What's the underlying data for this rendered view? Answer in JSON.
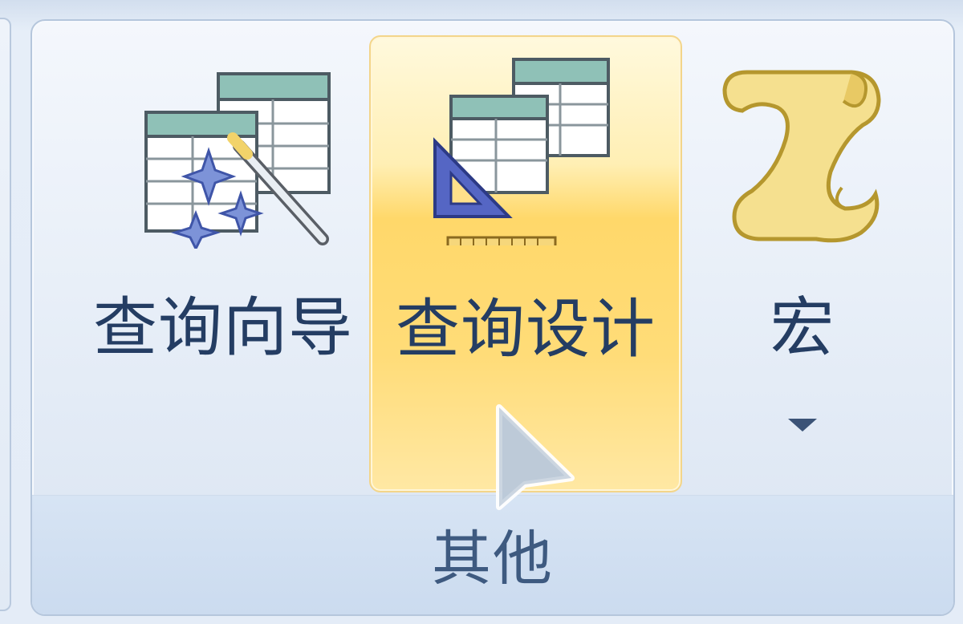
{
  "group": {
    "label": "其他"
  },
  "buttons": {
    "query_wizard": {
      "label": "查询向导",
      "icon": "query-wizard-icon"
    },
    "query_design": {
      "label": "查询设计",
      "icon": "query-design-icon",
      "state": "hover"
    },
    "macro": {
      "label": "宏",
      "icon": "macro-scroll-icon",
      "has_dropdown": true
    }
  },
  "colors": {
    "hover_highlight": "#ffd86a",
    "table_header": "#8fbfb5",
    "label_text": "#243d63",
    "group_label_text": "#3e5a80",
    "scroll": "#f3dc86"
  }
}
